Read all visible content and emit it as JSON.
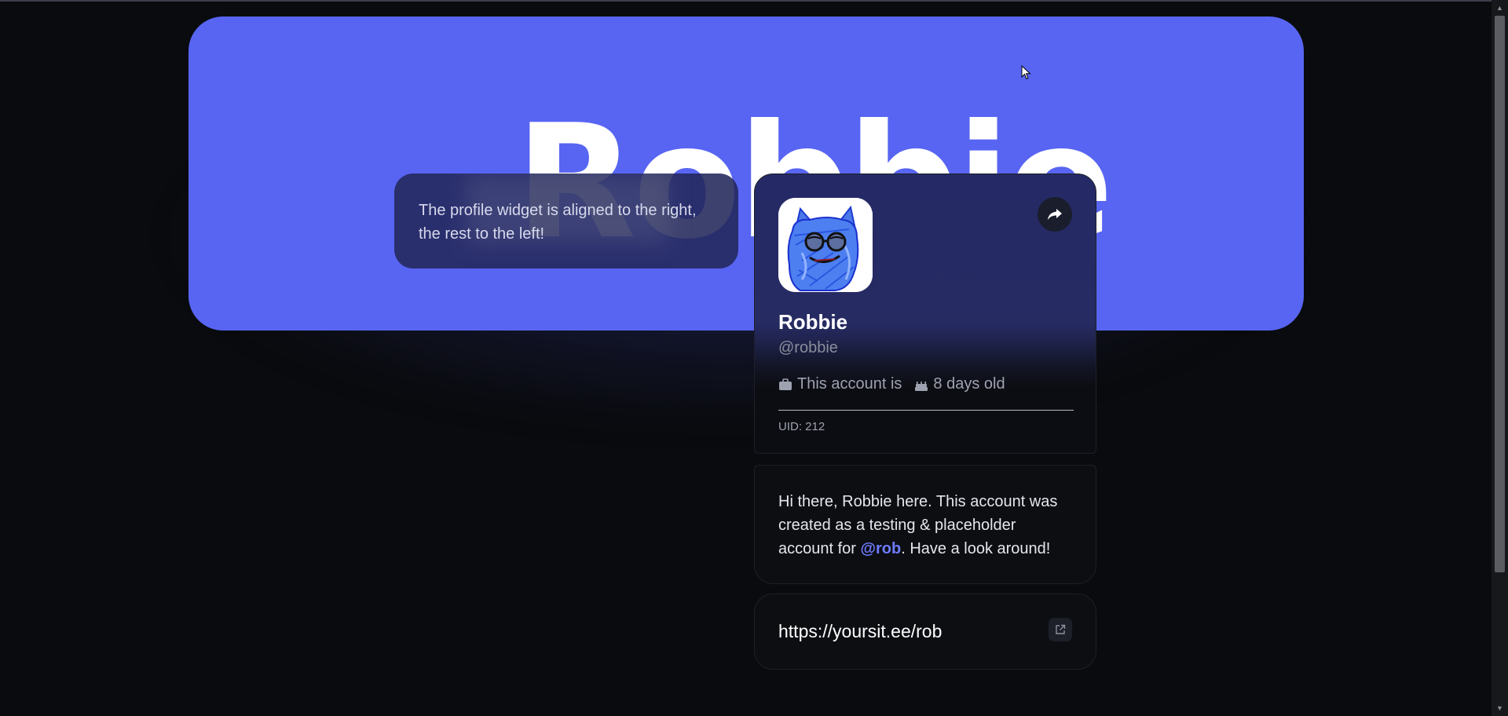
{
  "banner": {
    "name_text": "Robbie",
    "color": "#5865f2"
  },
  "info_card": {
    "text": "The profile widget is aligned to the right, the rest to the left!"
  },
  "profile": {
    "display_name": "Robbie",
    "handle": "@robbie",
    "meta": {
      "account_text": "This account is",
      "age_text": "8 days old"
    },
    "uid_text": "UID: 212",
    "share_icon": "share-arrow-icon"
  },
  "bio": {
    "text_before": "Hi there, Robbie here. This account was created as a testing & placeholder account for ",
    "mention": "@rob",
    "text_after": ". Have a look around!",
    "mention_color": "#6d7bff"
  },
  "link": {
    "url_text": "https://yoursit.ee/rob",
    "open_icon": "external-link-icon"
  }
}
